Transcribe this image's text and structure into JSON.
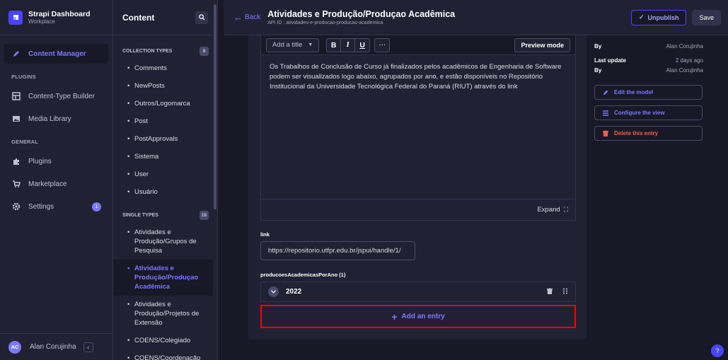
{
  "brand": {
    "title": "Strapi Dashboard",
    "subtitle": "Workplace"
  },
  "mainnav": {
    "content_manager": "Content Manager",
    "plugins_section": "PLUGINS",
    "content_type_builder": "Content-Type Builder",
    "media_library": "Media Library",
    "general_section": "GENERAL",
    "plugins": "Plugins",
    "marketplace": "Marketplace",
    "settings": "Settings",
    "settings_badge": "1"
  },
  "user": {
    "initials": "AC",
    "name": "Alan Corujinha",
    "collapse": "‹"
  },
  "subnav": {
    "title": "Content",
    "collection_types": "COLLECTION TYPES",
    "collection_count": "8",
    "collection_items": [
      "Comments",
      "NewPosts",
      "Outros/Logomarca",
      "Post",
      "PostApprovals",
      "Sistema",
      "User",
      "Usuário"
    ],
    "single_types": "SINGLE TYPES",
    "single_count": "18",
    "single_items": [
      "Atividades e Produção/Grupos de Pesquisa",
      "Atividades e Produção/Produçao Acadêmica",
      "Atividades e Produção/Projetos de Extensão",
      "COENS/Colegiado",
      "COENS/Coordenação"
    ]
  },
  "header": {
    "back": "Back",
    "title": "Atividades e Produção/Produçao Acadêmica",
    "api_id": "API ID : atividades-e-producao-producao-academica",
    "unpublish": "Unpublish",
    "save": "Save"
  },
  "editor": {
    "heading_select": "Add a title",
    "bold": "B",
    "italic": "I",
    "underline": "U",
    "more": "···",
    "preview": "Preview mode",
    "text": "Os Trabalhos de Conclusão de Curso já finalizados pelos acadêmicos de Engenharia de Software podem ser visualizados logo abaixo, agrupados por ano, e estão disponíveis no Repositório Institucional da Universidade Tecnológica Federal do Paraná (RIUT) através do link",
    "expand": "Expand"
  },
  "link_field": {
    "label": "link",
    "value": "https://repositorio.utfpr.edu.br/jspui/handle/1/"
  },
  "component": {
    "label": "producoesAcademicasPorAno (1)",
    "entry_title": "2022",
    "add_entry": "Add an entry"
  },
  "info": {
    "created_by_label": "By",
    "created_by": "Alan Corujinha",
    "last_update_label": "Last update",
    "last_update": "2 days ago",
    "updated_by_label": "By",
    "updated_by": "Alan Corujinha"
  },
  "actions": {
    "edit_model": "Edit the model",
    "configure_view": "Configure the view",
    "delete_entry": "Delete this entry"
  },
  "help": "?",
  "colors": {
    "accent": "#7b79ff",
    "primary": "#4945ff",
    "danger": "#ee5e52",
    "highlight_border": "#ff0000"
  }
}
